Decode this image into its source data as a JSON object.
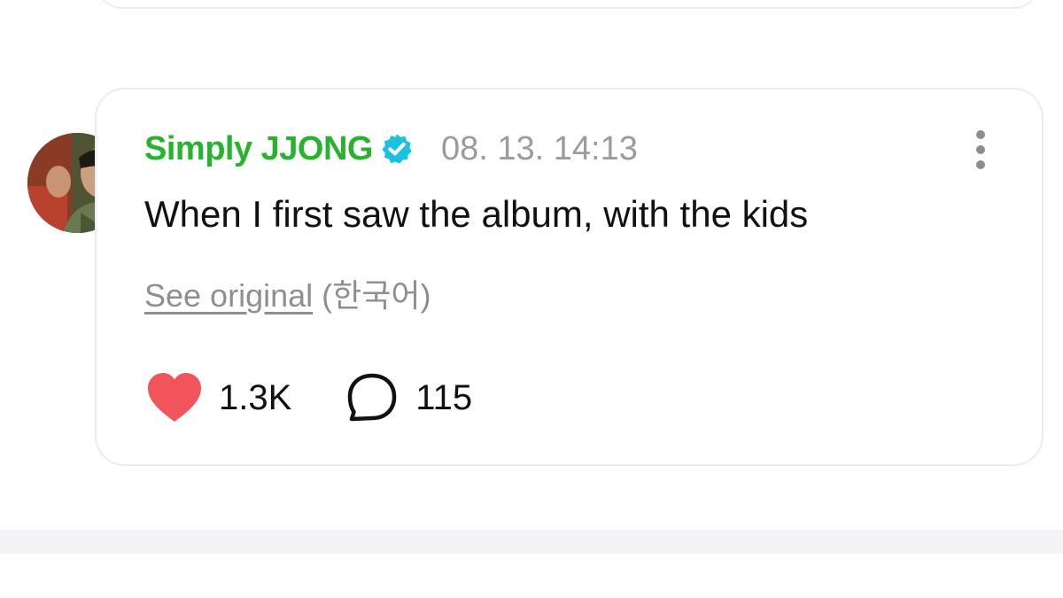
{
  "post": {
    "author": "Simply JJONG",
    "timestamp": "08. 13. 14:13",
    "text": "When I first saw the album, with the kids",
    "translation": {
      "see_original_label": "See original",
      "language": "(한국어)"
    },
    "likes": "1.3K",
    "comments": "115"
  },
  "icons": {
    "verified": "verified-badge-icon",
    "like": "heart-icon",
    "comment": "speech-bubble-icon",
    "more": "more-vertical-icon"
  },
  "colors": {
    "author_name": "#27b32e",
    "verified_badge": "#1cc0e0",
    "like_heart": "#f2545b",
    "muted_text": "#9b9b9b"
  }
}
